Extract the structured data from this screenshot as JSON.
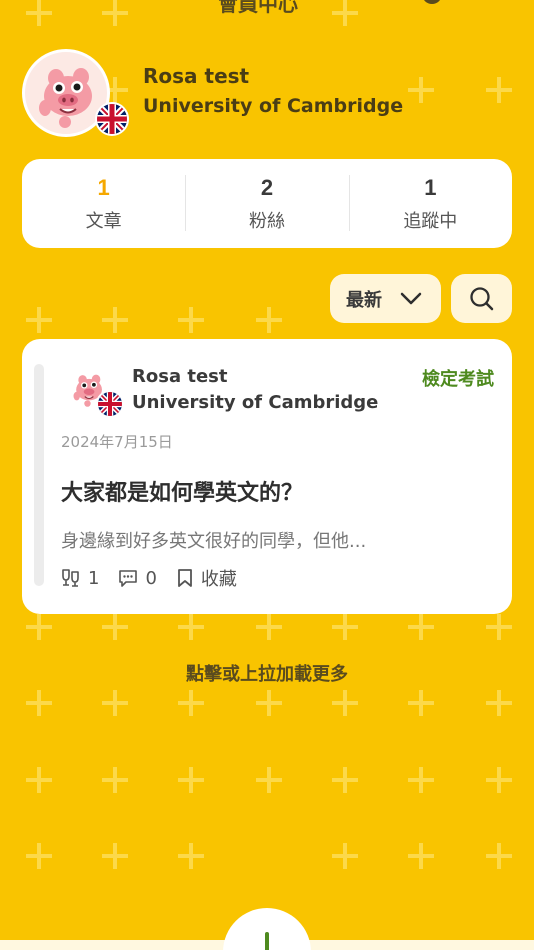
{
  "header": {
    "title": "會員中心",
    "icons": [
      "gear-icon",
      "more-icon"
    ]
  },
  "profile": {
    "name": "Rosa test",
    "school": "University of Cambridge",
    "avatar": "pig-avatar",
    "flag": "uk-flag"
  },
  "stats": [
    {
      "value": "1",
      "label": "文章"
    },
    {
      "value": "2",
      "label": "粉絲"
    },
    {
      "value": "1",
      "label": "追蹤中"
    }
  ],
  "toolbar": {
    "sort_label": "最新",
    "sort_icon": "chevron-down-icon",
    "search_icon": "search-icon"
  },
  "post": {
    "author": "Rosa test",
    "school": "University of Cambridge",
    "tag": "檢定考試",
    "date": "2024年7月15日",
    "title": "大家都是如何學英文的？",
    "excerpt": "身邊緣到好多英文很好的同學，但他...",
    "likes": "1",
    "comments": "0",
    "bookmark_label": "收藏"
  },
  "footer": {
    "load_more": "點擊或上拉加載更多"
  },
  "colors": {
    "background": "#F9C400",
    "accent": "#F5A800",
    "tag_green": "#4E8A1F"
  }
}
